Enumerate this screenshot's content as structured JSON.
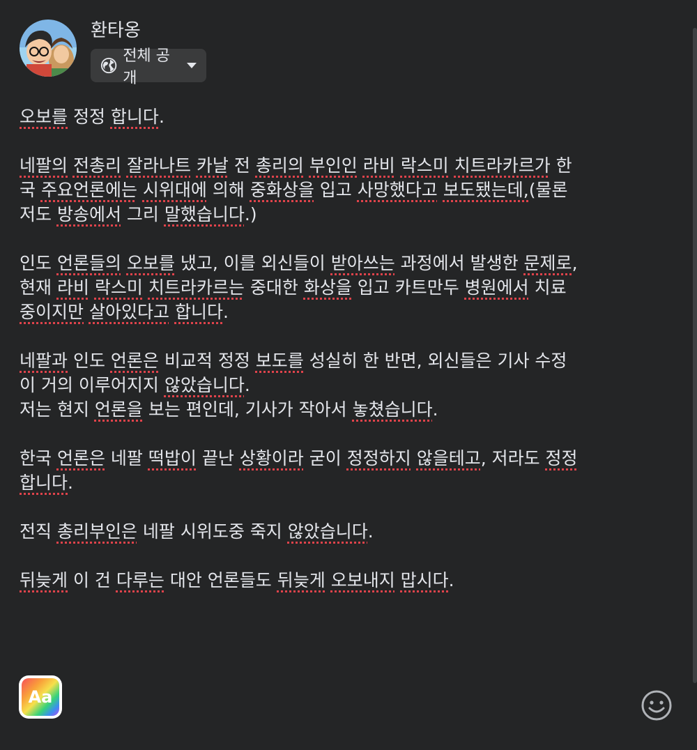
{
  "author": {
    "name": "환타옹",
    "avatar_icon": "avatar-cartoon-couple"
  },
  "privacy": {
    "label": "전체 공개",
    "icon": "globe-icon"
  },
  "post": {
    "lines": [
      "오보를 정정 합니다.",
      "",
      "네팔의 전총리 잘라나트 카날 전 총리의 부인인 라비 락스미 치트라카르가 한",
      "국 주요언론에는 시위대에 의해 중화상을 입고 사망했다고 보도됐는데,(물론",
      "저도 방송에서 그리 말했습니다.)",
      "",
      "인도 언론들의 오보를 냈고, 이를 외신들이 받아쓰는 과정에서 발생한 문제로,",
      "현재 라비 락스미 치트라카르는 중대한 화상을 입고 카트만두 병원에서 치료",
      "중이지만 살아있다고 합니다.",
      "",
      "네팔과 인도 언론은 비교적 정정 보도를 성실히 한 반면, 외신들은 기사 수정",
      "이 거의 이루어지지 않았습니다.",
      "저는 현지 언론을 보는 편인데, 기사가 작아서 놓쳤습니다.",
      "",
      "한국 언론은 네팔 떡밥이 끝난 상황이라 굳이 정정하지 않을테고, 저라도 정정",
      "합니다.",
      "",
      "전직 총리부인은 네팔 시위도중 죽지 않았습니다.",
      "",
      "뒤늦게 이 건 다루는 대안 언론들도 뒤늦게 오보내지 맙시다."
    ]
  },
  "toolbar": {
    "text_style_label": "Aa",
    "text_style_icon": "text-background-icon",
    "emoji_icon": "emoji-icon"
  },
  "colors": {
    "background": "#242526",
    "text": "#e4e6eb",
    "chip": "#3a3b3c",
    "spellcheck": "#e0434b"
  }
}
